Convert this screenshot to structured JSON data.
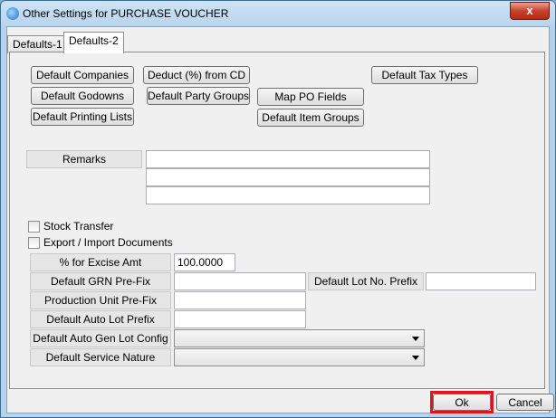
{
  "window": {
    "title": "Other Settings for PURCHASE VOUCHER",
    "close_glyph": "x"
  },
  "tabs": [
    {
      "label": "Defaults-1",
      "active": false
    },
    {
      "label": "Defaults-2",
      "active": true
    }
  ],
  "buttons": {
    "default_companies": "Default Companies",
    "deduct_from_cd": "Deduct (%) from CD",
    "default_tax_types": "Default Tax Types",
    "default_godowns": "Default Godowns",
    "default_party_groups": "Default Party Groups",
    "map_po_fields": "Map PO Fields",
    "default_printing_lists": "Default Printing Lists",
    "default_item_groups": "Default Item Groups"
  },
  "remarks": {
    "label": "Remarks",
    "lines": [
      "",
      "",
      ""
    ]
  },
  "checkboxes": {
    "stock_transfer": {
      "label": "Stock Transfer",
      "checked": false
    },
    "export_import": {
      "label": "Export / Import Documents",
      "checked": false
    }
  },
  "fields": {
    "excise_amt": {
      "label": "% for Excise Amt",
      "value": "100.0000"
    },
    "grn_prefix": {
      "label": "Default GRN Pre-Fix",
      "value": ""
    },
    "lot_no_prefix": {
      "label": "Default Lot No. Prefix",
      "value": ""
    },
    "production_unit_prefix": {
      "label": "Production Unit Pre-Fix",
      "value": ""
    },
    "auto_lot_prefix": {
      "label": "Default Auto Lot Prefix",
      "value": ""
    },
    "auto_gen_lot_config": {
      "label": "Default Auto Gen Lot Config",
      "value": ""
    },
    "service_nature": {
      "label": "Default Service Nature",
      "value": ""
    }
  },
  "footer": {
    "ok": "Ok",
    "cancel": "Cancel"
  },
  "colors": {
    "highlight": "#e0151b",
    "close_button": "#c8412c"
  }
}
